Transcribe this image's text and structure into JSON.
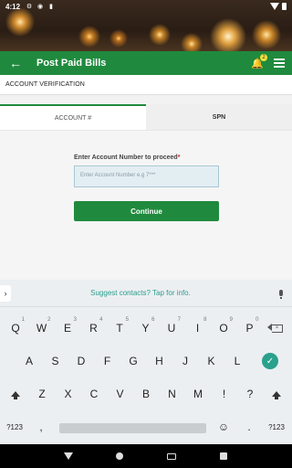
{
  "status": {
    "time": "4:12"
  },
  "toolbar": {
    "title": "Post Paid Bills",
    "notification_count": "2"
  },
  "section": {
    "title": "ACCOUNT VERIFICATION"
  },
  "tabs": [
    {
      "label": "ACCOUNT #"
    },
    {
      "label": "SPN"
    }
  ],
  "form": {
    "label": "Enter Account Number to proceed",
    "required_mark": "*",
    "placeholder": "Enter Account Number e.g 7***",
    "button": "Continue"
  },
  "keyboard": {
    "suggestion": "Suggest contacts? Tap for info.",
    "row1": [
      {
        "k": "Q",
        "s": "1"
      },
      {
        "k": "W",
        "s": "2"
      },
      {
        "k": "E",
        "s": "3"
      },
      {
        "k": "R",
        "s": "4"
      },
      {
        "k": "T",
        "s": "5"
      },
      {
        "k": "Y",
        "s": "6"
      },
      {
        "k": "U",
        "s": "7"
      },
      {
        "k": "I",
        "s": "8"
      },
      {
        "k": "O",
        "s": "9"
      },
      {
        "k": "P",
        "s": "0"
      }
    ],
    "row2": [
      "A",
      "S",
      "D",
      "F",
      "G",
      "H",
      "J",
      "K",
      "L"
    ],
    "row3": [
      "Z",
      "X",
      "C",
      "V",
      "B",
      "N",
      "M",
      "!",
      "?"
    ],
    "sym_label": "?123",
    "comma": ",",
    "period": "."
  }
}
